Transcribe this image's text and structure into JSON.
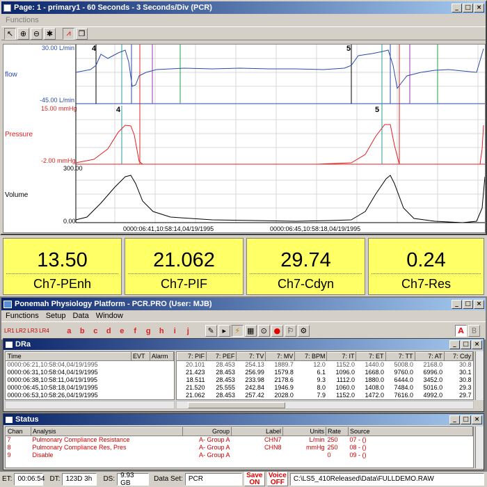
{
  "top_window": {
    "title": "Page: 1 - primary1 - 60 Seconds - 3 Seconds/Div (PCR)",
    "menu": [
      "Functions"
    ],
    "channels": [
      {
        "name": "flow",
        "max": "30.00 L/min",
        "min": "-45.00 L/min",
        "color": "#2a4aa8"
      },
      {
        "name": "Pressure",
        "max": "15.00 mmHg",
        "min": "-2.00 mmHg",
        "color": "#e02020"
      },
      {
        "name": "Volume",
        "max": "300.00",
        "min": "0.00",
        "color": "#000000"
      }
    ],
    "markers": {
      "flow_left": "4",
      "flow_right": "5",
      "pressure_left": "4",
      "pressure_right": "5"
    },
    "time_labels": [
      "0000:06:41,10:58:14,04/19/1995",
      "0000:06:45,10:58:18,04/19/1995"
    ]
  },
  "param_boxes": [
    {
      "value": "13.50",
      "name": "Ch7-PEnh"
    },
    {
      "value": "21.062",
      "name": "Ch7-PIF"
    },
    {
      "value": "29.74",
      "name": "Ch7-Cdyn"
    },
    {
      "value": "0.24",
      "name": "Ch7-Res"
    }
  ],
  "main_window": {
    "title": "Ponemah Physiology Platform - PCR.PRO (User: MJB)",
    "menu": [
      "Functions",
      "Setup",
      "Data",
      "Window"
    ],
    "lr_buttons": [
      "LR1",
      "LR2",
      "LR3",
      "LR4"
    ],
    "letter_buttons": [
      "a",
      "b",
      "c",
      "d",
      "e",
      "f",
      "g",
      "h",
      "i",
      "j"
    ],
    "ab_buttons": [
      "A",
      "B"
    ]
  },
  "dra": {
    "title": "DRa",
    "left_headers": [
      "Time",
      "EVT",
      "Alarm"
    ],
    "left_rows": [
      "0000:06:21,10:58:04,04/19/1995",
      "0000:06:31,10:58:04,04/19/1995",
      "0000:06:38,10:58:11,04/19/1995",
      "0000:06:45,10:58:18,04/19/1995",
      "0000:06:53,10:58:26,04/19/1995"
    ],
    "right_headers": [
      "7:  PIF",
      "7:  PEF",
      "7:  TV",
      "7:  MV",
      "7:  BPM",
      "7:  IT",
      "7:  ET",
      "7:  TT",
      "7:  AT",
      "7:  Cdy"
    ],
    "right_rows": [
      [
        "20.101",
        "28.453",
        "254.13",
        "1889.7",
        "12.0",
        "1152.0",
        "1440.0",
        "5008.0",
        "2168.0",
        "30.8"
      ],
      [
        "21.423",
        "28.453",
        "256.99",
        "1579.8",
        "6.1",
        "1096.0",
        "1668.0",
        "9760.0",
        "6996.0",
        "30.1"
      ],
      [
        "18.511",
        "28.453",
        "233.98",
        "2178.6",
        "9.3",
        "1112.0",
        "1880.0",
        "6444.0",
        "3452.0",
        "30.8"
      ],
      [
        "21.520",
        "25.555",
        "242.84",
        "1946.9",
        "8.0",
        "1060.0",
        "1408.0",
        "7484.0",
        "5016.0",
        "29.3"
      ],
      [
        "21.062",
        "28.453",
        "257.42",
        "2028.0",
        "7.9",
        "1152.0",
        "1472.0",
        "7616.0",
        "4992.0",
        "29.7"
      ]
    ]
  },
  "status": {
    "title": "Status",
    "headers": [
      "Chan",
      "Analysis",
      "Group",
      "Label",
      "Units",
      "Rate",
      "Source"
    ],
    "rows": [
      [
        "7",
        "Pulmonary Compliance Resistance",
        "A- Group A",
        "CHN7",
        "L/min",
        "250",
        "07 - ()"
      ],
      [
        "8",
        "Pulmonary Compliance Res, Pres",
        "A- Group A",
        "CHN8",
        "mmHg",
        "250",
        "08 - ()"
      ],
      [
        "9",
        "Disable",
        "A- Group A",
        "",
        "",
        "0",
        "09 - ()"
      ]
    ]
  },
  "statusbar": {
    "et_label": "ET:",
    "et_value": "00:06:54",
    "dt_label": "DT:",
    "dt_value": "123D 3h",
    "ds_label": "DS:",
    "ds_value": "9.93 GB",
    "dataset_label": "Data Set:",
    "dataset_value": "PCR",
    "save_label": "Save",
    "save_state": "ON",
    "voice_label": "Voice",
    "voice_state": "OFF",
    "path": "C:\\LS5_410Released\\Data\\FULLDEMO.RAW"
  }
}
